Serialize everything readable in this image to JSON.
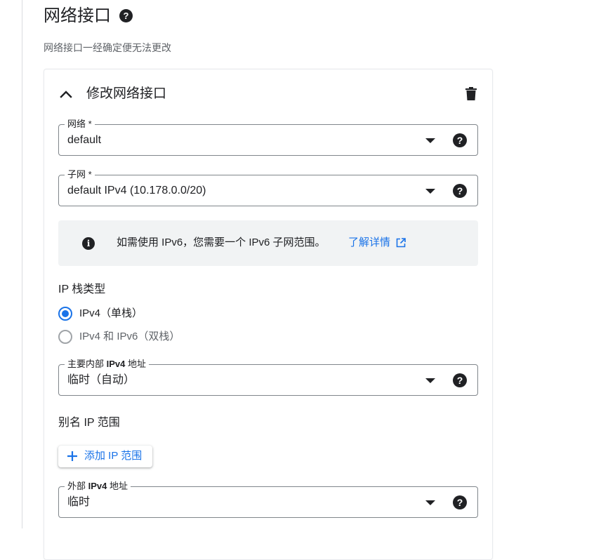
{
  "section": {
    "title": "网络接口",
    "subtitle": "网络接口一经确定便无法更改"
  },
  "card": {
    "title": "修改网络接口"
  },
  "network_field": {
    "label": "网络 *",
    "value": "default"
  },
  "subnet_field": {
    "label": "子网 *",
    "value": "default IPv4 (10.178.0.0/20)"
  },
  "info": {
    "text": "如需使用 IPv6，您需要一个 IPv6 子网范围。",
    "link": "了解详情"
  },
  "ip_stack": {
    "label": "IP 栈类型",
    "options": [
      {
        "label": "IPv4（单栈）",
        "checked": true
      },
      {
        "label": "IPv4 和 IPv6（双栈）",
        "checked": false
      }
    ]
  },
  "internal_ip_field": {
    "label_prefix": "主要内部 ",
    "label_bold": "IPv4",
    "label_suffix": " 地址",
    "value": "临时（自动）"
  },
  "alias": {
    "label": "别名 IP 范围",
    "add_button": "添加 IP 范围"
  },
  "external_ip_field": {
    "label_prefix": "外部 ",
    "label_bold": "IPv4",
    "label_suffix": " 地址",
    "value": "临时"
  },
  "colors": {
    "accent": "#1a73e8",
    "text": "#202124",
    "muted": "#5f6368",
    "info_bg": "#f1f3f4"
  },
  "icons": {
    "help": "question-circle",
    "collapse": "chevron-up",
    "delete": "trash",
    "info": "info-circle",
    "external": "open-in-new",
    "add": "plus",
    "dropdown": "caret-down"
  }
}
